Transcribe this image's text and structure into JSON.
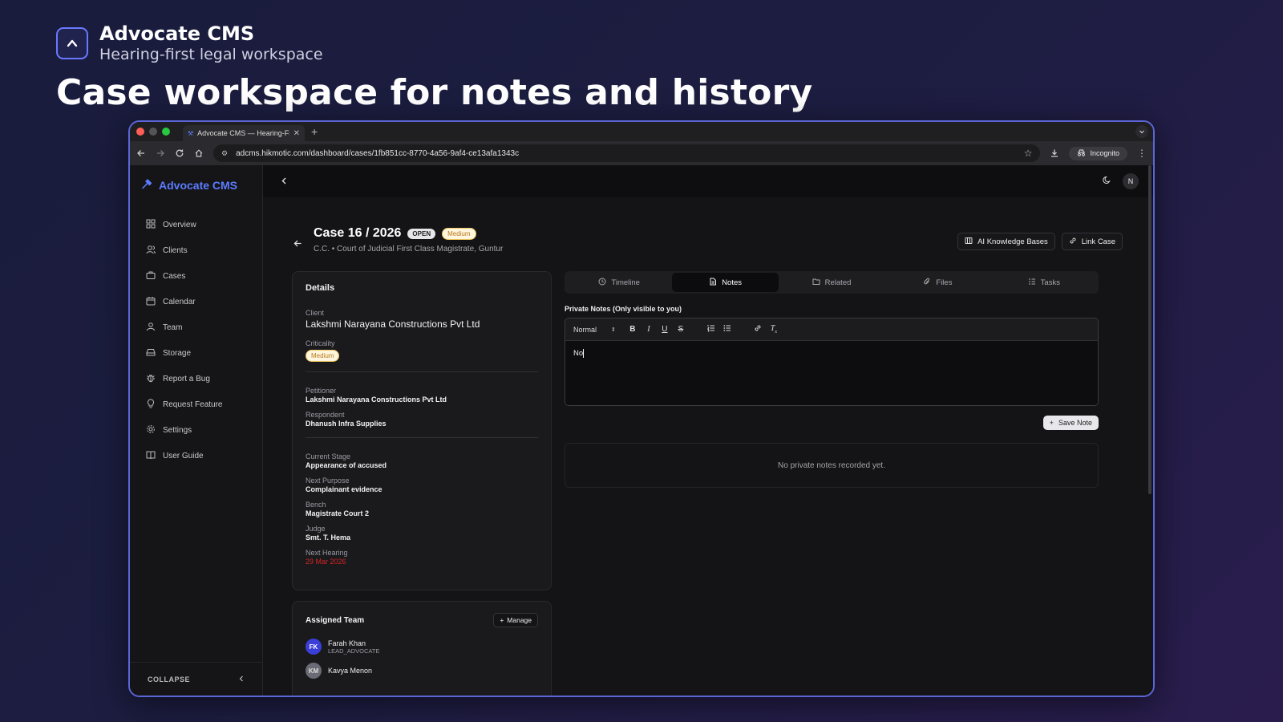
{
  "brand": {
    "name": "Advocate CMS",
    "tagline": "Hearing-first legal workspace"
  },
  "headline": "Case workspace for notes and history",
  "browser": {
    "tab_title": "Advocate CMS — Hearing-Fi",
    "url": "adcms.hikmotic.com/dashboard/cases/1fb851cc-8770-4a56-9af4-ce13afa1343c",
    "incognito_label": "Incognito"
  },
  "sidebar": {
    "logo": "Advocate CMS",
    "items": [
      {
        "label": "Overview",
        "icon": "grid-icon"
      },
      {
        "label": "Clients",
        "icon": "users-icon"
      },
      {
        "label": "Cases",
        "icon": "briefcase-icon"
      },
      {
        "label": "Calendar",
        "icon": "calendar-icon"
      },
      {
        "label": "Team",
        "icon": "team-icon"
      },
      {
        "label": "Storage",
        "icon": "storage-icon"
      },
      {
        "label": "Report a Bug",
        "icon": "bug-icon"
      },
      {
        "label": "Request Feature",
        "icon": "lightbulb-icon"
      },
      {
        "label": "Settings",
        "icon": "gear-icon"
      },
      {
        "label": "User Guide",
        "icon": "book-icon"
      }
    ],
    "collapse_label": "COLLAPSE"
  },
  "topbar": {
    "avatar_initial": "N"
  },
  "case": {
    "title": "Case 16 / 2026",
    "status": "OPEN",
    "criticality_badge": "Medium",
    "subtitle": "C.C. • Court of Judicial First Class Magistrate, Guntur",
    "actions": {
      "ai_kb": "AI Knowledge Bases",
      "link_case": "Link Case"
    }
  },
  "details": {
    "title": "Details",
    "client_label": "Client",
    "client": "Lakshmi Narayana Constructions Pvt Ltd",
    "criticality_label": "Criticality",
    "criticality": "Medium",
    "petitioner_label": "Petitioner",
    "petitioner": "Lakshmi Narayana Constructions Pvt Ltd",
    "respondent_label": "Respondent",
    "respondent": "Dhanush Infra Supplies",
    "stage_label": "Current Stage",
    "stage": "Appearance of accused",
    "purpose_label": "Next Purpose",
    "purpose": "Complainant evidence",
    "bench_label": "Bench",
    "bench": "Magistrate Court 2",
    "judge_label": "Judge",
    "judge": "Smt. T. Hema",
    "hearing_label": "Next Hearing",
    "hearing": "29 Mar 2026"
  },
  "team": {
    "title": "Assigned Team",
    "manage_label": "Manage",
    "members": [
      {
        "initials": "FK",
        "name": "Farah Khan",
        "role": "LEAD_ADVOCATE",
        "color": "#3b3fd8"
      },
      {
        "initials": "KM",
        "name": "Kavya Menon",
        "role": "",
        "color": "#6b6b75"
      }
    ]
  },
  "workspace": {
    "tabs": [
      {
        "label": "Timeline",
        "icon": "clock-icon"
      },
      {
        "label": "Notes",
        "icon": "document-icon"
      },
      {
        "label": "Related",
        "icon": "folder-icon"
      },
      {
        "label": "Files",
        "icon": "paperclip-icon"
      },
      {
        "label": "Tasks",
        "icon": "list-icon"
      }
    ],
    "active_tab": "Notes",
    "notes_label": "Private Notes (Only visible to you)",
    "format_select": "Normal",
    "editor_text": "No",
    "save_label": "Save Note",
    "empty_text": "No private notes recorded yet."
  },
  "colors": {
    "accent": "#5b7cff",
    "danger": "#d52424",
    "medium_badge": "#b7791f"
  }
}
